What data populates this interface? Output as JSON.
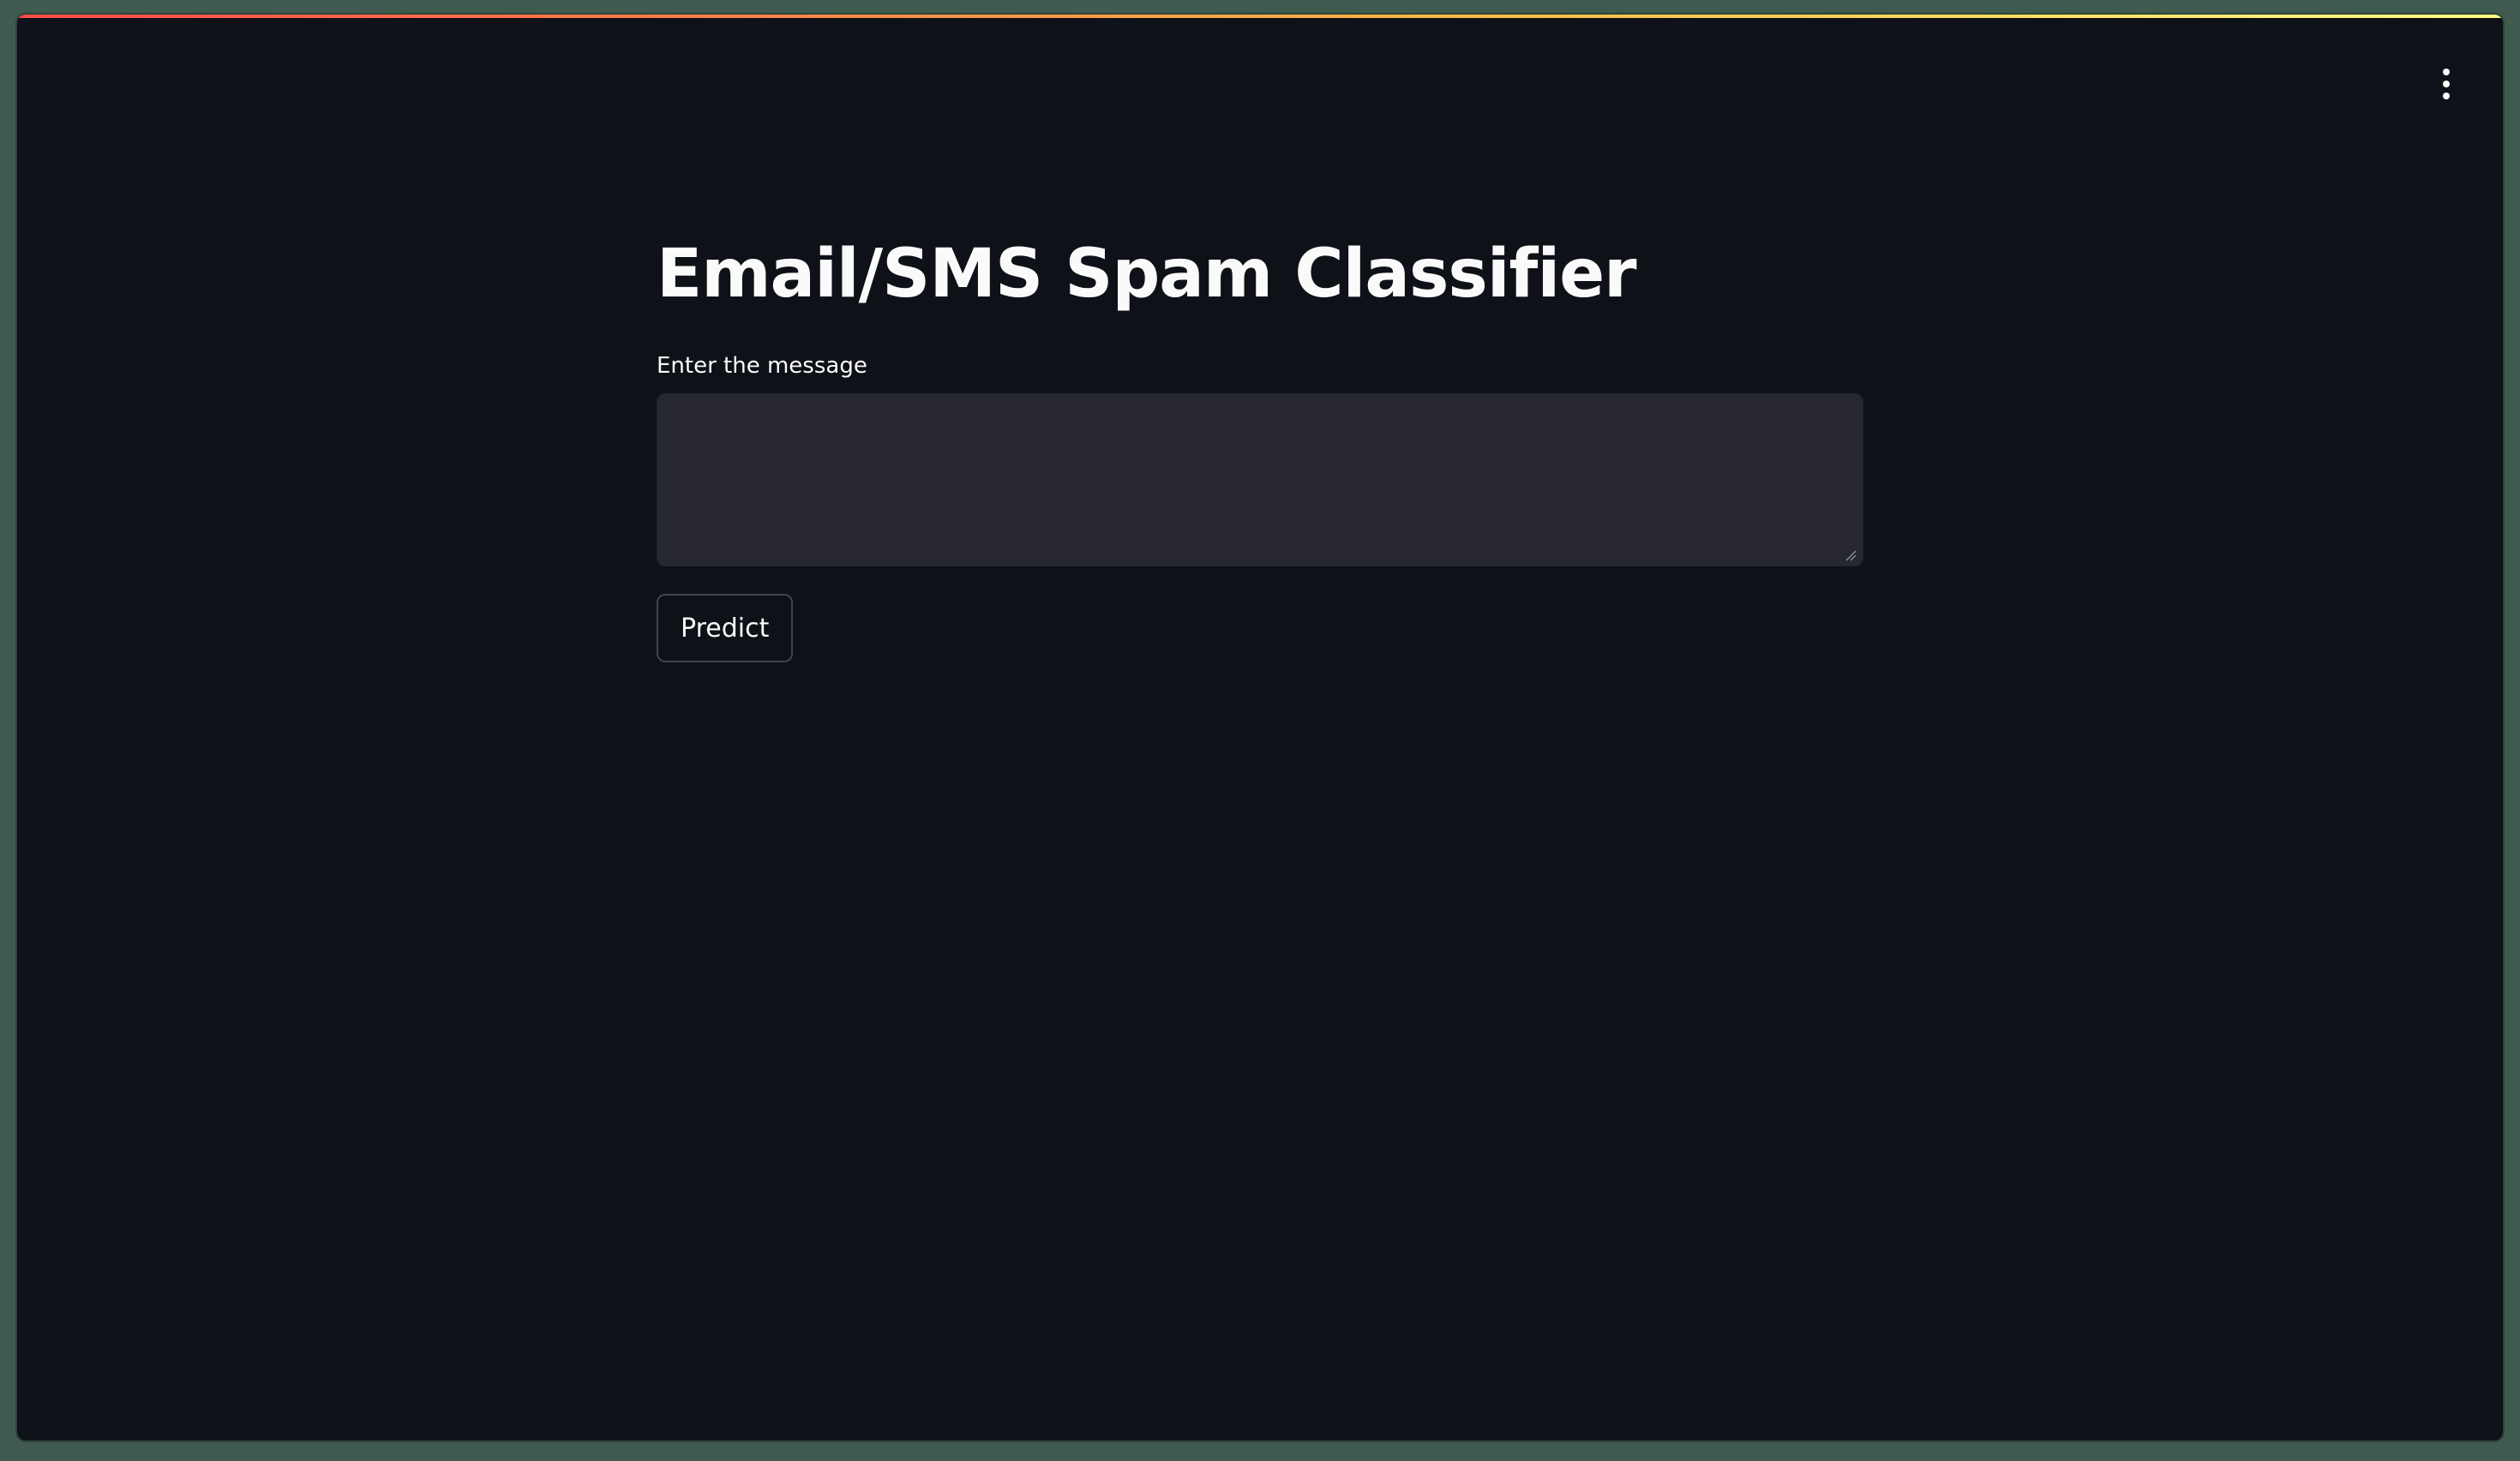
{
  "app": {
    "title": "Email/SMS Spam Classifier",
    "menu_icon": "kebab-menu-icon",
    "accent_gradient": [
      "#ff4b4b",
      "#ffbd45",
      "#fffd80"
    ],
    "background": "#0e1117"
  },
  "form": {
    "message_label": "Enter the message",
    "message_value": "",
    "predict_label": "Predict"
  }
}
